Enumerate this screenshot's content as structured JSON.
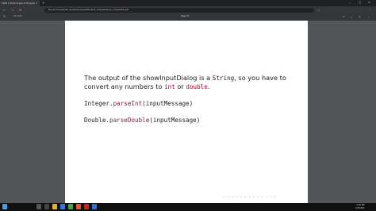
{
  "browser": {
    "tab_title": "CMPS 1 SP Principles of Program...",
    "tab_close": "×",
    "new_tab": "+",
    "window_controls": [
      "–",
      "□",
      "×"
    ],
    "nav_back": "←",
    "nav_forward": "→",
    "nav_reload": "⟳",
    "address": "file:///C:/Users/tyler_work/Downloads/06-input_output/lecture_notes/slides.pdf",
    "bookmark_icon": "☆",
    "extension_icon": "⋮"
  },
  "pdf_toolbar": {
    "menu_icon": "☰",
    "pages_label": "21 of 25",
    "zoom_label": "Page fit",
    "right_icons": [
      "↻",
      "⤓",
      "⎙",
      "⋮"
    ]
  },
  "slide": {
    "line1_prefix": "The output of the showInputDialog is a ",
    "line1_code": "String",
    "line1_suffix": ", so you have to",
    "line2_prefix": "convert any numbers to ",
    "line2_int": "int",
    "line2_or": " or ",
    "line2_double": "double",
    "line2_end": ".",
    "code1_class": "Integer.",
    "code1_method": "parseInt",
    "code1_args": "(inputMessage)",
    "code2_class": "Double.",
    "code2_method": "parseDouble",
    "code2_args": "(inputMessage)",
    "footer_nav": "◁ ▷ ◁ ▷ ◁ ▷ ◁ ▷ ◁ ▷ ∽ ◁ ▷"
  },
  "taskbar": {
    "time": "2:24 PM",
    "date": "2/3/2021"
  }
}
